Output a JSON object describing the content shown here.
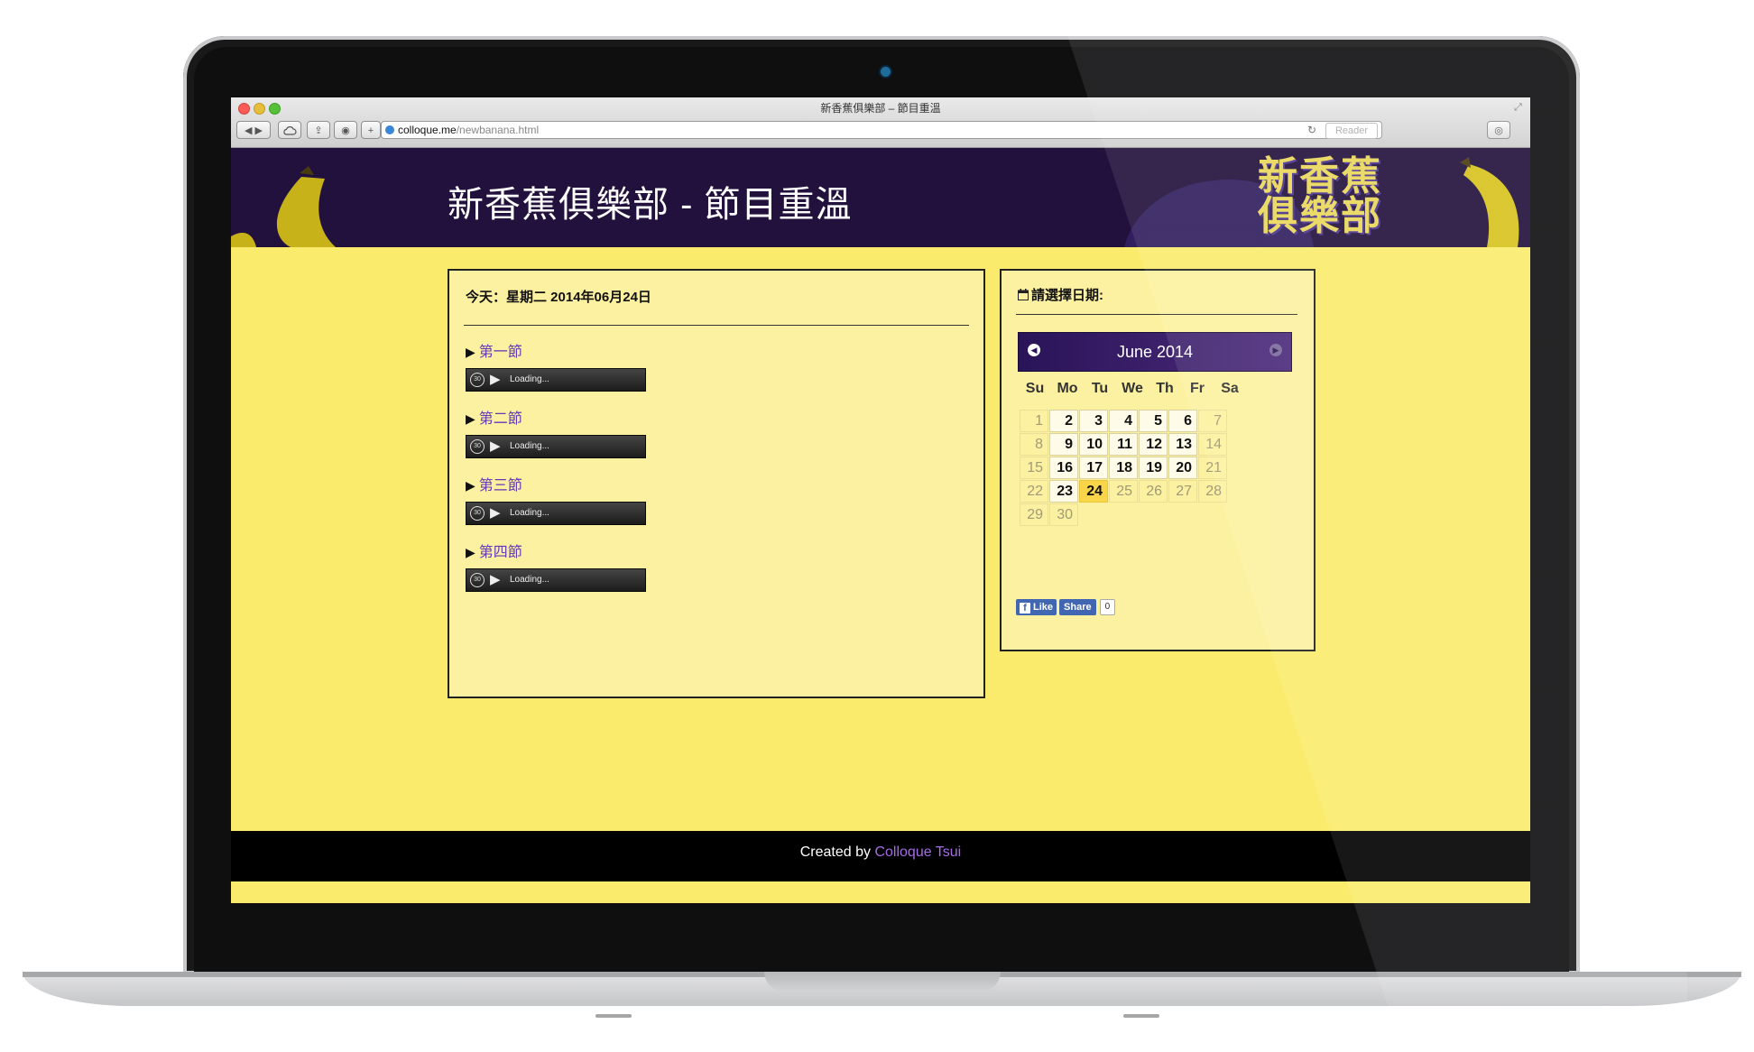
{
  "browser": {
    "window_title": "新香蕉俱樂部 – 節目重溫",
    "url_domain": "colloque.me",
    "url_path": "/newbanana.html",
    "reader_label": "Reader",
    "traffic_colors": [
      "#fc5b57",
      "#e5bf3c",
      "#57c038"
    ]
  },
  "header": {
    "title": "新香蕉俱樂部 - 節目重溫",
    "logo_text": "新香蕉俱樂部",
    "background": "#22103d"
  },
  "today": {
    "label": "今天：星期二 2014年06月24日"
  },
  "segments": [
    {
      "title": "第一節",
      "player_status": "Loading..."
    },
    {
      "title": "第二節",
      "player_status": "Loading..."
    },
    {
      "title": "第三節",
      "player_status": "Loading..."
    },
    {
      "title": "第四節",
      "player_status": "Loading..."
    }
  ],
  "calendar": {
    "prompt": "請選擇日期:",
    "month_label": "June 2014",
    "weekdays": [
      "Su",
      "Mo",
      "Tu",
      "We",
      "Th",
      "Fr",
      "Sa"
    ],
    "weeks": [
      [
        {
          "d": "1",
          "s": "off"
        },
        {
          "d": "2",
          "s": "on"
        },
        {
          "d": "3",
          "s": "on"
        },
        {
          "d": "4",
          "s": "on"
        },
        {
          "d": "5",
          "s": "on"
        },
        {
          "d": "6",
          "s": "on"
        },
        {
          "d": "7",
          "s": "off"
        }
      ],
      [
        {
          "d": "8",
          "s": "off"
        },
        {
          "d": "9",
          "s": "on"
        },
        {
          "d": "10",
          "s": "on"
        },
        {
          "d": "11",
          "s": "on"
        },
        {
          "d": "12",
          "s": "on"
        },
        {
          "d": "13",
          "s": "on"
        },
        {
          "d": "14",
          "s": "off"
        }
      ],
      [
        {
          "d": "15",
          "s": "off"
        },
        {
          "d": "16",
          "s": "on"
        },
        {
          "d": "17",
          "s": "on"
        },
        {
          "d": "18",
          "s": "on"
        },
        {
          "d": "19",
          "s": "on"
        },
        {
          "d": "20",
          "s": "on"
        },
        {
          "d": "21",
          "s": "off"
        }
      ],
      [
        {
          "d": "22",
          "s": "off"
        },
        {
          "d": "23",
          "s": "on"
        },
        {
          "d": "24",
          "s": "today"
        },
        {
          "d": "25",
          "s": "off"
        },
        {
          "d": "26",
          "s": "off"
        },
        {
          "d": "27",
          "s": "off"
        },
        {
          "d": "28",
          "s": "off"
        }
      ],
      [
        {
          "d": "29",
          "s": "off"
        },
        {
          "d": "30",
          "s": "off"
        }
      ]
    ],
    "accent": "#2a1458"
  },
  "social": {
    "like_label": "Like",
    "share_label": "Share",
    "count": "0"
  },
  "footer": {
    "prefix": "Created by ",
    "author": "Colloque Tsui"
  }
}
